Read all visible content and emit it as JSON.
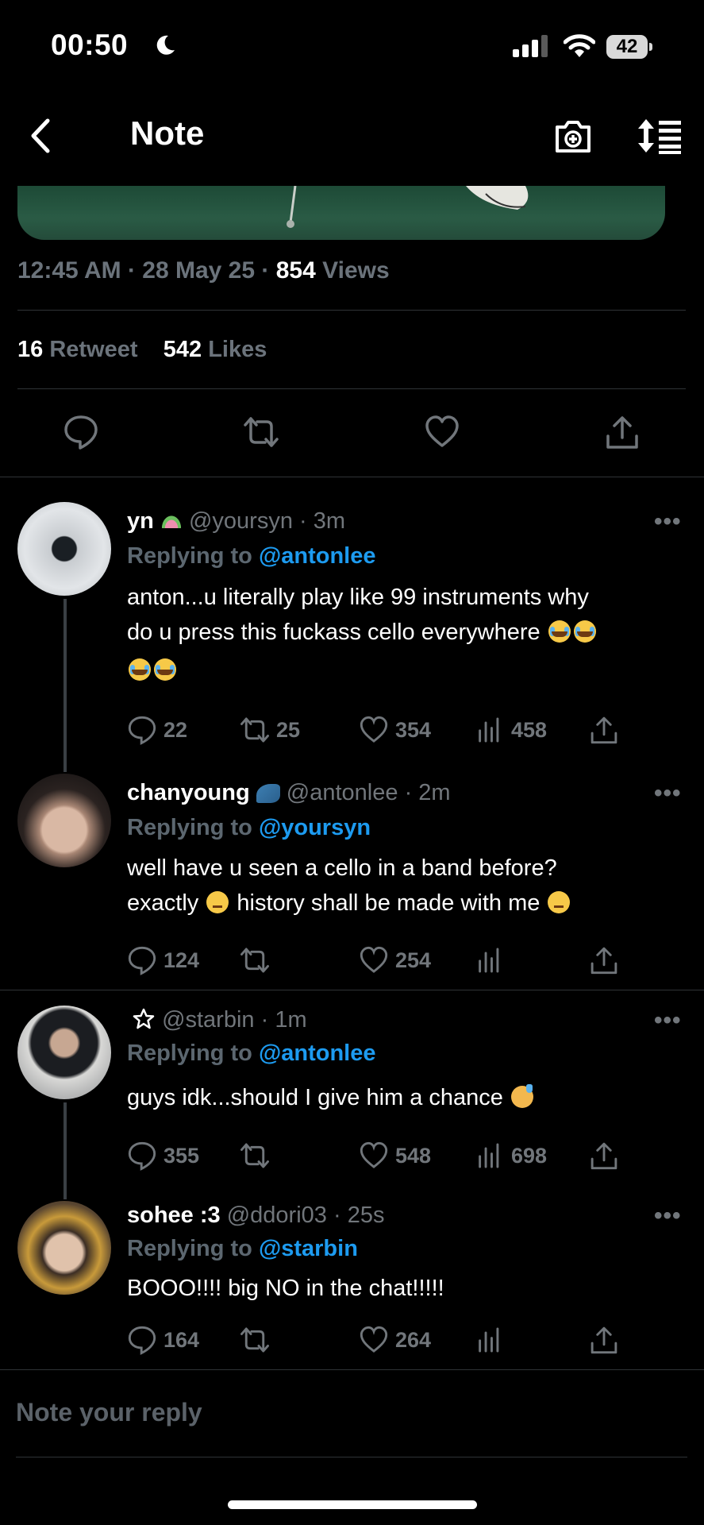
{
  "status_bar": {
    "time": "00:50",
    "battery": "42"
  },
  "header": {
    "title": "Note"
  },
  "post": {
    "time": "12:45 AM",
    "date": "28 May 25",
    "views_count": "854",
    "views_label": "Views",
    "retweets_count": "16",
    "retweets_label": "Retweet",
    "likes_count": "542",
    "likes_label": "Likes"
  },
  "replies": [
    {
      "name": "yn",
      "handle": "@yoursyn",
      "time": "3m",
      "replying_prefix": "Replying to",
      "replying_to": "@antonlee",
      "text_line1": "anton...u literally play like 99 instruments why",
      "text_line2": "do u press this fuckass cello everywhere",
      "comments": "22",
      "retweets": "25",
      "likes": "354",
      "views": "458"
    },
    {
      "name": "chanyoung",
      "handle": "@antonlee",
      "time": "2m",
      "replying_prefix": "Replying to",
      "replying_to": "@yoursyn",
      "text_line1": "well have u seen a cello in a band before?",
      "text_line2a": "exactly",
      "text_line2b": "history shall be made with me",
      "comments": "124",
      "retweets": "",
      "likes": "254",
      "views": ""
    },
    {
      "name": "",
      "handle": "@starbin",
      "time": "1m",
      "replying_prefix": "Replying to",
      "replying_to": "@antonlee",
      "text_line1": "guys idk...should I give him a chance",
      "comments": "355",
      "retweets": "",
      "likes": "548",
      "views": "698"
    },
    {
      "name": "sohee :3",
      "handle": "@ddori03",
      "time": "25s",
      "replying_prefix": "Replying to",
      "replying_to": "@starbin",
      "text_line1": "BOOO!!!! big NO in the chat!!!!!",
      "comments": "164",
      "retweets": "",
      "likes": "264",
      "views": ""
    }
  ],
  "compose": {
    "placeholder": "Note your reply"
  }
}
